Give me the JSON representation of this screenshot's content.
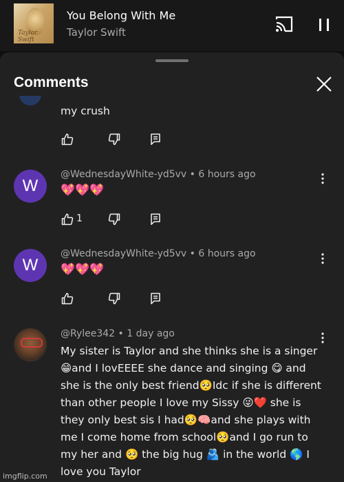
{
  "now_playing": {
    "title": "You Belong With Me",
    "artist": "Taylor Swift",
    "art_script": "Taylor Swift",
    "icons": {
      "cast": "cast-icon",
      "pause": "pause-icon"
    }
  },
  "comments_sheet": {
    "title": "Comments",
    "close_icon": "close-icon"
  },
  "comments": [
    {
      "text": "my crush",
      "like_count": ""
    },
    {
      "author": "@WednesdayWhite-yd5vv",
      "time": "• 6 hours ago",
      "avatar_letter": "W",
      "text": "💖💖💖",
      "like_count": "1"
    },
    {
      "author": "@WednesdayWhite-yd5vv",
      "time": "• 6 hours ago",
      "avatar_letter": "W",
      "text": "💖💖💖",
      "like_count": ""
    },
    {
      "author": "@Rylee342",
      "time": "• 1 day ago",
      "lines": [
        "My sister is Taylor and she thinks she is a singer",
        "😁and I lovEEEE she dance and singing 😋 and",
        "she is the only best friend🥺Idc if she is different",
        "than other people I love my Sissy 😜❤️ she is",
        "they only best sis I had🥺🧠and she plays with",
        "me I come home from school🥺and I go run to",
        "my her and 🥺 the big hug 🫂 in the world 🌎 I",
        "love you Taylor"
      ]
    }
  ],
  "colors": {
    "background": "#0f0f0f",
    "sheet": "#212121",
    "avatar_purple": "#5e35b1",
    "secondary_text": "#aaaaaa"
  },
  "watermark": "imgflip.com"
}
